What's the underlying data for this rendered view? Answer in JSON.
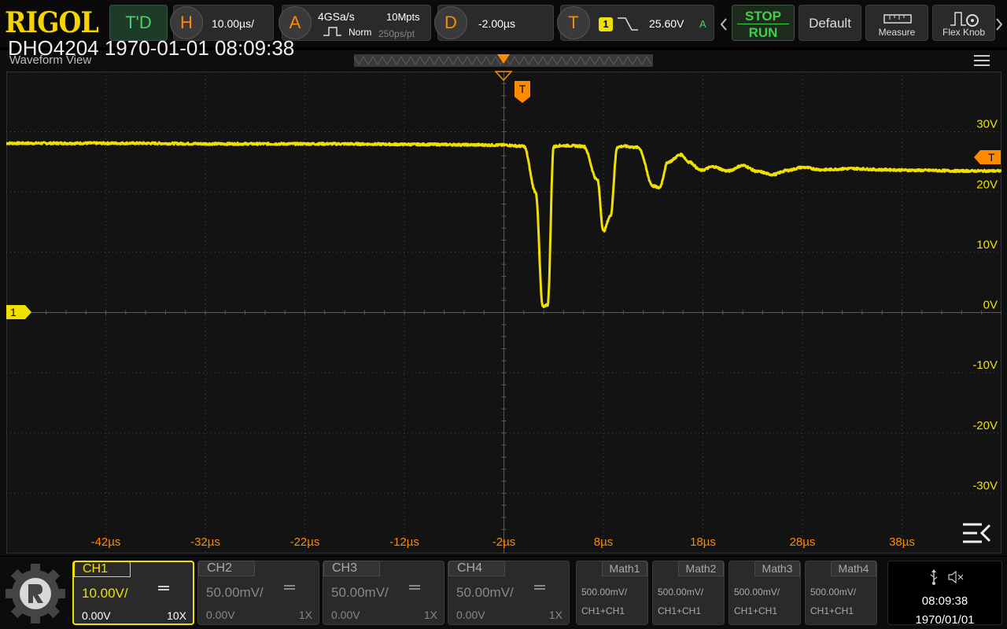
{
  "brand": "RIGOL",
  "overlay_title": "DHO4204 1970-01-01 08:09:38",
  "toolbar": {
    "trigger_delay_label": "T'D",
    "horizontal": {
      "letter": "H",
      "value": "10.00µs/"
    },
    "acquire": {
      "letter": "A",
      "sample_rate": "4GSa/s",
      "mode": "Norm",
      "memory_depth": "10Mpts",
      "resolution": "250ps/pt"
    },
    "delay": {
      "letter": "D",
      "value": "-2.00µs"
    },
    "trigger": {
      "letter": "T",
      "source": "1",
      "level": "25.60V",
      "status": "A"
    },
    "stop_label": "STOP",
    "run_label": "RUN",
    "default_label": "Default",
    "measure_label": "Measure",
    "flex_knob_label": "Flex Knob"
  },
  "waveform_view": {
    "title": "Waveform View",
    "trigger_marker": "T",
    "channel_marker": "1",
    "trigger_level_marker": "T",
    "y_ticks": [
      "30V",
      "20V",
      "10V",
      "0V",
      "-10V",
      "-20V",
      "-30V"
    ],
    "x_ticks": [
      "-42µs",
      "-32µs",
      "-22µs",
      "-12µs",
      "-2µs",
      "8µs",
      "18µs",
      "28µs",
      "38µs"
    ]
  },
  "chart_data": {
    "type": "line",
    "title": "",
    "xlabel": "",
    "ylabel": "",
    "x_unit": "µs",
    "y_unit": "V",
    "xlim": [
      -52,
      48
    ],
    "ylim": [
      -40,
      40
    ],
    "grid": true,
    "trigger_level": 25.6,
    "series": [
      {
        "color": "#f0e000",
        "x": [
          -52,
          -40,
          -30,
          -20,
          -10,
          -2,
          0,
          1.2,
          1.9,
          2.4,
          3.0,
          3.5,
          4.5,
          6.0,
          7.4,
          8.0,
          8.7,
          9.4,
          10.0,
          11.5,
          13.0,
          13.6,
          14.5,
          15.8,
          16.6,
          17.8,
          19.0,
          20.5,
          22.0,
          23.5,
          25.0,
          26.5,
          28.0,
          30.0,
          33.0,
          36.0,
          40.0,
          44.0,
          48.0
        ],
        "y": [
          28.1,
          28.1,
          28.0,
          28.0,
          27.9,
          27.8,
          27.6,
          20.0,
          1.0,
          1.3,
          27.5,
          27.7,
          27.7,
          27.6,
          22.0,
          13.5,
          16.0,
          27.5,
          27.6,
          27.4,
          21.0,
          20.7,
          25.0,
          26.2,
          25.0,
          23.6,
          24.2,
          23.5,
          24.4,
          23.4,
          22.9,
          23.6,
          24.1,
          23.7,
          23.9,
          23.7,
          23.6,
          23.5,
          23.5
        ]
      }
    ]
  },
  "channels": [
    {
      "name": "CH1",
      "scale": "10.00V/",
      "offset": "0.00V",
      "probe": "10X",
      "active": true,
      "color": "#f0e000"
    },
    {
      "name": "CH2",
      "scale": "50.00mV/",
      "offset": "0.00V",
      "probe": "1X",
      "active": false
    },
    {
      "name": "CH3",
      "scale": "50.00mV/",
      "offset": "0.00V",
      "probe": "1X",
      "active": false
    },
    {
      "name": "CH4",
      "scale": "50.00mV/",
      "offset": "0.00V",
      "probe": "1X",
      "active": false
    }
  ],
  "math": [
    {
      "name": "Math1",
      "scale": "500.00mV/",
      "source": "CH1+CH1"
    },
    {
      "name": "Math2",
      "scale": "500.00mV/",
      "source": "CH1+CH1"
    },
    {
      "name": "Math3",
      "scale": "500.00mV/",
      "source": "CH1+CH1"
    },
    {
      "name": "Math4",
      "scale": "500.00mV/",
      "source": "CH1+CH1"
    }
  ],
  "status": {
    "time": "08:09:38",
    "date": "1970/01/01"
  },
  "icons": [
    "rigol-gear-icon",
    "usb-icon",
    "speaker-mute-icon",
    "measure-icon",
    "flex-knob-icon",
    "hamburger-menu-icon",
    "collapse-menu-icon",
    "chevron-left-icon",
    "chevron-right-icon"
  ]
}
